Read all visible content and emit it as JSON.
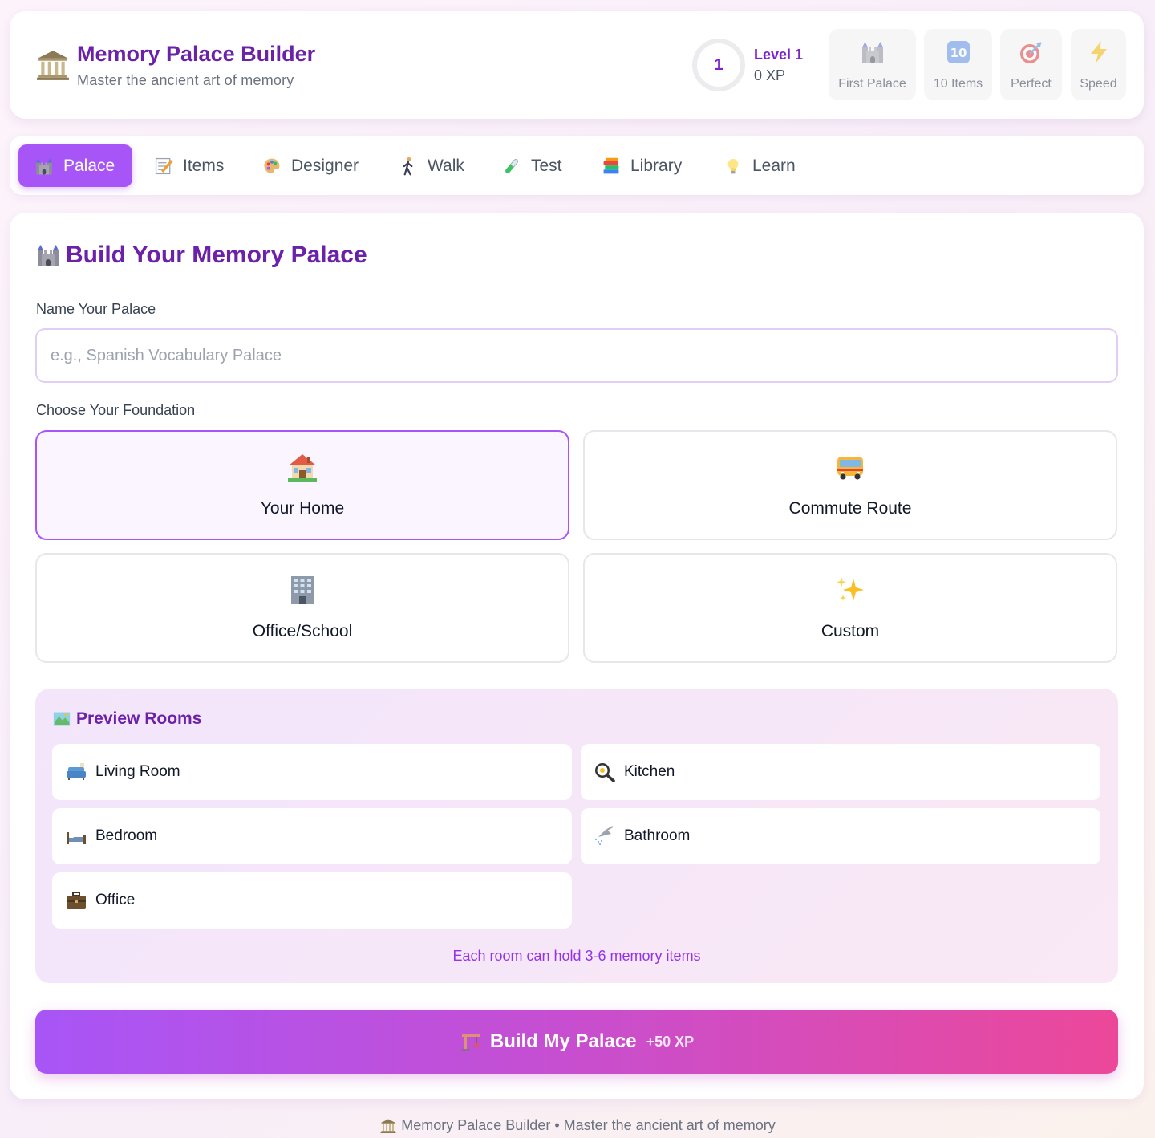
{
  "header": {
    "title": "Memory Palace Builder",
    "subtitle": "Master the ancient art of memory",
    "logo_icon": "classical-building-icon",
    "level_number": "1",
    "level_label": "Level 1",
    "xp_label": "0 XP",
    "badges": [
      {
        "label": "First Palace",
        "icon": "castle-icon"
      },
      {
        "label": "10 Items",
        "icon": "keycap-ten-icon"
      },
      {
        "label": "Perfect",
        "icon": "target-icon"
      },
      {
        "label": "Speed",
        "icon": "lightning-icon"
      }
    ]
  },
  "tabs": [
    {
      "label": "Palace",
      "icon": "castle-icon",
      "active": true
    },
    {
      "label": "Items",
      "icon": "memo-icon"
    },
    {
      "label": "Designer",
      "icon": "palette-icon"
    },
    {
      "label": "Walk",
      "icon": "walking-person-icon"
    },
    {
      "label": "Test",
      "icon": "test-tube-icon"
    },
    {
      "label": "Library",
      "icon": "books-icon"
    },
    {
      "label": "Learn",
      "icon": "light-bulb-icon"
    }
  ],
  "main": {
    "title": "Build Your Memory Palace",
    "name_label": "Name Your Palace",
    "name_placeholder": "e.g., Spanish Vocabulary Palace",
    "name_value": "",
    "foundation_label": "Choose Your Foundation",
    "foundations": [
      {
        "label": "Your Home",
        "icon": "house-icon",
        "selected": true
      },
      {
        "label": "Commute Route",
        "icon": "bus-icon"
      },
      {
        "label": "Office/School",
        "icon": "office-building-icon"
      },
      {
        "label": "Custom",
        "icon": "sparkles-icon"
      }
    ],
    "preview": {
      "title": "Preview Rooms",
      "icon": "map-icon",
      "rooms": [
        {
          "label": "Living Room",
          "icon": "couch-icon"
        },
        {
          "label": "Kitchen",
          "icon": "frying-pan-icon"
        },
        {
          "label": "Bedroom",
          "icon": "bed-icon"
        },
        {
          "label": "Bathroom",
          "icon": "shower-icon"
        },
        {
          "label": "Office",
          "icon": "briefcase-icon"
        }
      ],
      "note": "Each room can hold 3-6 memory items"
    },
    "build_button": {
      "label": "Build My Palace",
      "xp": "+50 XP",
      "icon": "construction-crane-icon"
    }
  },
  "footer": {
    "text": "Memory Palace Builder • Master the ancient art of memory",
    "icon": "classical-building-icon"
  },
  "colors": {
    "accent": "#a855f7",
    "title": "#6b21a8",
    "gradient_end": "#ec4899"
  }
}
